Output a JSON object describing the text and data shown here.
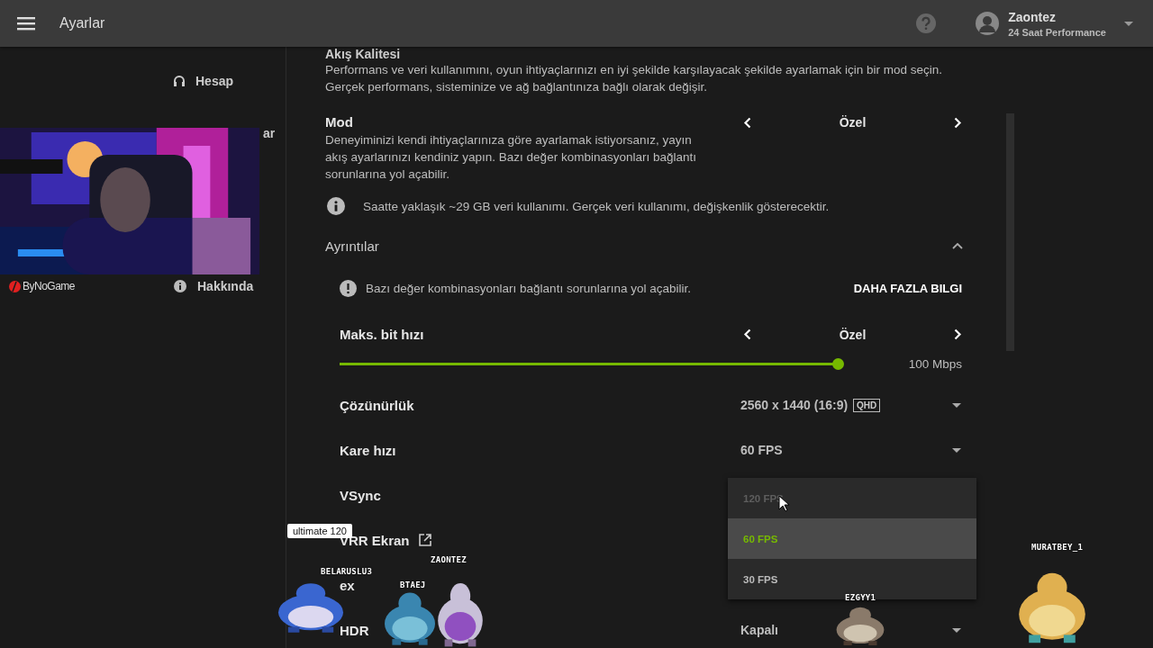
{
  "header": {
    "title": "Ayarlar",
    "user_name": "Zaontez",
    "user_plan": "24 Saat Performance"
  },
  "sidebar": {
    "items": [
      {
        "label": "Hesap"
      },
      {
        "label": "ar"
      },
      {
        "label": "Hakkında"
      }
    ]
  },
  "webcam": {
    "kind": "picture",
    "brand": "ByNoGame"
  },
  "stream_quality": {
    "title": "Akış Kalitesi",
    "description": "Performans ve veri kullanımını, oyun ihtiyaçlarınızı en iyi şekilde karşılayacak şekilde ayarlamak için bir mod seçin. Gerçek performans, sisteminize ve ağ bağlantınıza bağlı olarak değişir.",
    "mode": {
      "label": "Mod",
      "description": "Deneyiminizi kendi ihtiyaçlarınıza göre ayarlamak istiyorsanız, yayın akış ayarlarınızı kendiniz yapın. Bazı değer kombinasyonları bağlantı sorunlarına yol açabilir.",
      "value": "Özel"
    },
    "data_note": "Saatte yaklaşık ~29 GB veri kullanımı. Gerçek veri kullanımı, değişkenlik gösterecektir.",
    "details": {
      "label": "Ayrıntılar",
      "expanded": true,
      "warning": "Bazı değer kombinasyonları bağlantı sorunlarına yol açabilir.",
      "more_link": "DAHA FAZLA BILGI",
      "bitrate": {
        "label": "Maks. bit hızı",
        "value": "Özel",
        "level": 1,
        "reading": "100 Mbps"
      },
      "settings": [
        {
          "kind": "dropdown",
          "label": "Çözünürlük",
          "value": "2560 x 1440 (16:9)",
          "tag": "QHD"
        },
        {
          "kind": "dropdown",
          "label": "Kare hızı",
          "value": "60 FPS"
        },
        {
          "kind": "plain",
          "label": "VSync"
        },
        {
          "kind": "link",
          "label": "VRR Ekran"
        },
        {
          "kind": "plain",
          "label": "ex"
        },
        {
          "kind": "dropdown",
          "label": "HDR",
          "value": "Kapalı"
        }
      ]
    }
  },
  "dropdown_menu": {
    "options": [
      {
        "label": "120 FPS",
        "disabled": true,
        "selected": false
      },
      {
        "label": "60 FPS",
        "disabled": false,
        "selected": true
      },
      {
        "label": "30 FPS",
        "disabled": false,
        "selected": false
      }
    ]
  },
  "overlay": {
    "tooltip": "ultimate 120",
    "sprites": [
      {
        "name": "BELARUSLU3"
      },
      {
        "name": "BTAEJ"
      },
      {
        "name": "ZAONTEZ"
      },
      {
        "name": "EZGYY1"
      },
      {
        "name": "MURATBEY_1"
      }
    ]
  }
}
